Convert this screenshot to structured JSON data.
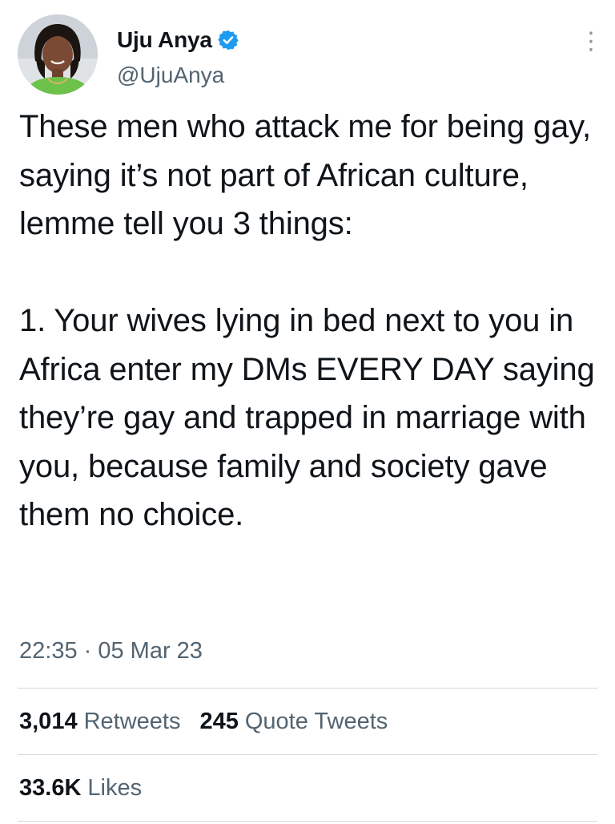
{
  "author": {
    "display_name": "Uju Anya",
    "handle": "@UjuAnya",
    "verified": true,
    "avatar_icon": "profile-photo-avatar"
  },
  "tweet": {
    "text": "These men who attack me for being gay, saying it’s not part of African culture, lemme tell you 3 things:\n\n1. Your wives lying in bed next to you in Africa enter my DMs EVERY DAY saying they’re gay and trapped in marriage with you, because family and society gave them no choice.",
    "timestamp": "22:35 · 05 Mar 23"
  },
  "stats": {
    "retweets_count": "3,014",
    "retweets_label": "Retweets",
    "quotes_count": "245",
    "quotes_label": "Quote Tweets",
    "likes_count": "33.6K",
    "likes_label": "Likes"
  },
  "colors": {
    "text": "#0f1419",
    "secondary": "#536471",
    "verified": "#1d9bf0",
    "divider": "#cfd9de"
  },
  "icons": {
    "verified": "verified-badge-icon",
    "more": "more-options-icon"
  }
}
